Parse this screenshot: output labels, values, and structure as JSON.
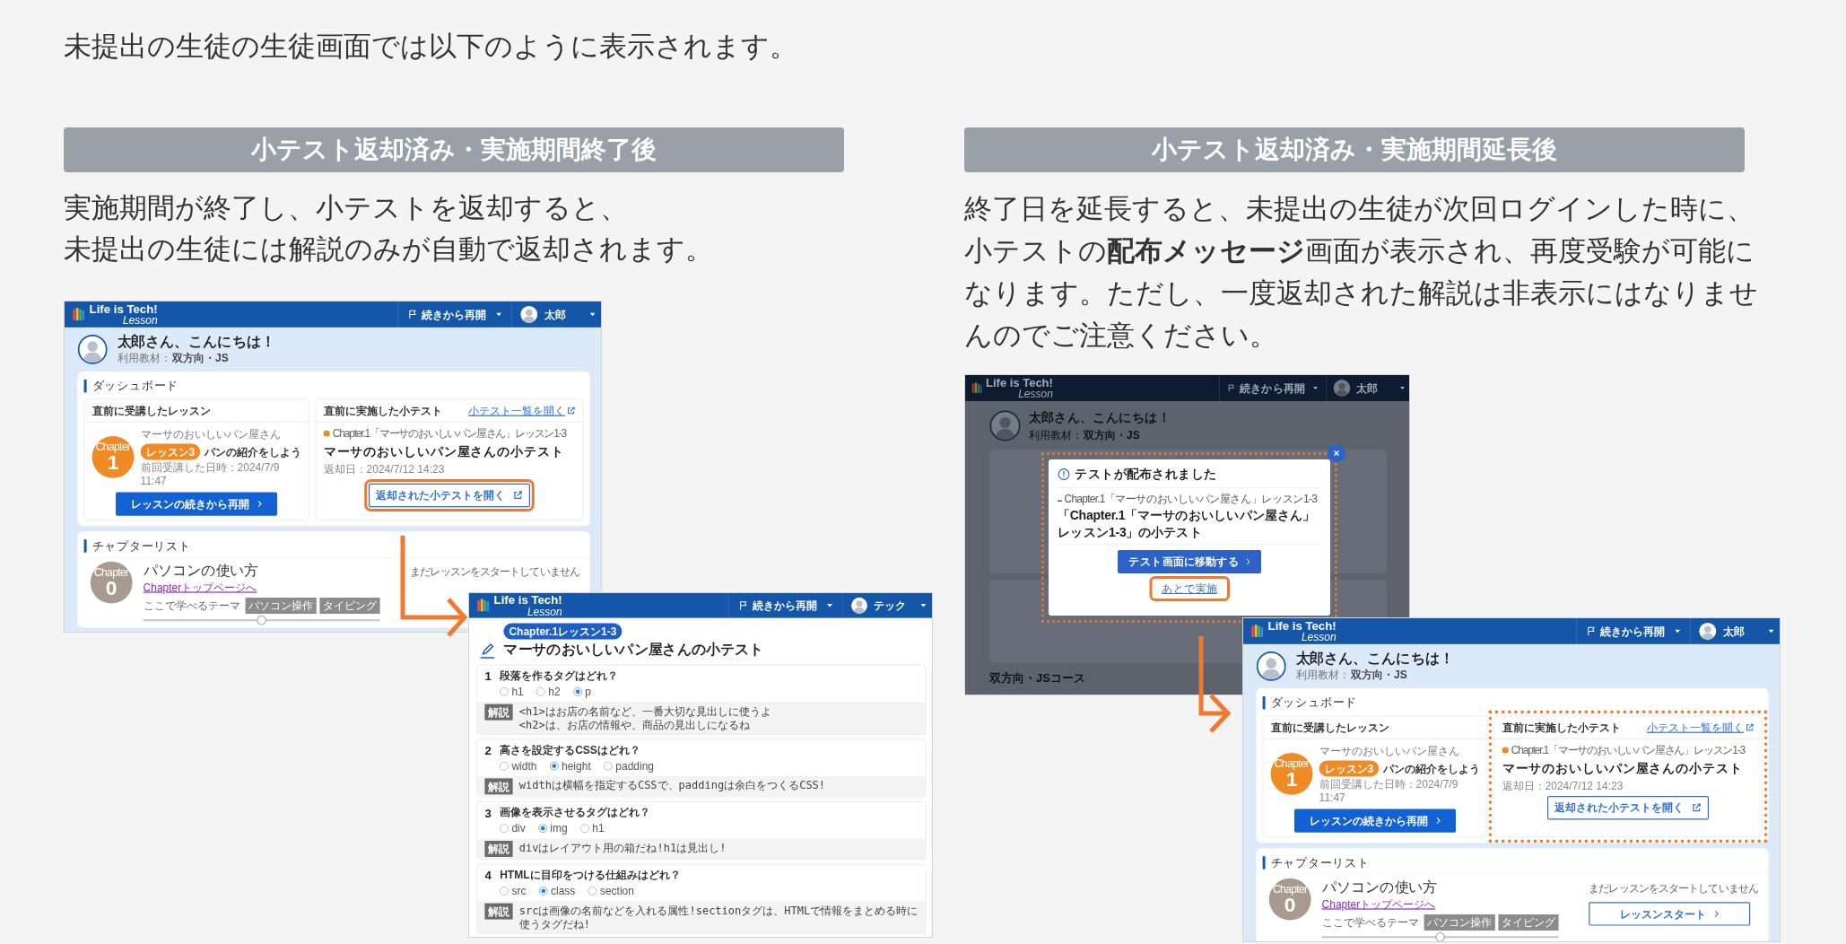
{
  "intro": "未提出の生徒の生徒画面では以下のように表示されます。",
  "columns": [
    {
      "heading": "小テスト返却済み・実施期間終了後",
      "lines": [
        "実施期間が終了し、小テストを返却すると、",
        "未提出の生徒には解説のみが自動で返却されます。"
      ],
      "screens": [
        {
          "kind": "dashboard",
          "logo": {
            "name": "Life is Tech!",
            "sub": "Lesson"
          },
          "topbar": {
            "resume": "続きから再開",
            "user": "太郎"
          },
          "greeting": "太郎さん、こんにちは！",
          "material_label": "利用教材：",
          "material": "双方向・JS",
          "dashboard_title": "ダッシュボード",
          "last_lesson": {
            "title": "直前に受講したレッスン",
            "chapter_label": "Chapter",
            "chapter_number": "1",
            "course": "マーサのおいしいパン屋さん",
            "lesson_badge": "レッスン3",
            "lesson_title": "パンの紹介をしよう",
            "last_viewed": "前回受講した日時：2024/7/9 11:47",
            "button": "レッスンの続きから再開"
          },
          "last_quiz": {
            "title": "直前に実施した小テスト",
            "list_link": "小テスト一覧を開く",
            "chapter_line": "Chapter.1「マーサのおいしいパン屋さん」レッスン1-3",
            "quiz_title": "マーサのおいしいパン屋さんの小テスト",
            "returned": "返却日：2024/7/12 14:23",
            "button": "返却された小テストを開く",
            "highlighted": false,
            "button_highlighted": true
          },
          "chapter_list": {
            "title": "チャプターリスト",
            "chapter_label": "Chapter",
            "chapter_number": "0",
            "name": "パソコンの使い方",
            "link": "Chapterトップページへ",
            "themes_label": "ここで学べるテーマ",
            "tags": [
              "パソコン操作",
              "タイピング"
            ],
            "level": 0.5,
            "status": "まだレッスンをスタートしていません"
          }
        },
        {
          "kind": "quiz",
          "logo": {
            "name": "Life is Tech!",
            "sub": "Lesson"
          },
          "topbar": {
            "resume": "続きから再開",
            "user": "テック"
          },
          "badge": "Chapter.1レッスン1-3",
          "title": "マーサのおいしいパン屋さんの小テスト",
          "questions": [
            {
              "number": "1",
              "text": "段落を作るタグはどれ？",
              "options": [
                {
                  "label": "h1",
                  "selected": false
                },
                {
                  "label": "h2",
                  "selected": false
                },
                {
                  "label": "p",
                  "selected": true
                }
              ],
              "explanation_label": "解説",
              "explanation": [
                "<h1>はお店の名前など、一番大切な見出しに使うよ",
                "<h2>は、お店の情報や、商品の見出しになるね"
              ]
            },
            {
              "number": "2",
              "text": "高さを設定するCSSはどれ？",
              "options": [
                {
                  "label": "width",
                  "selected": false
                },
                {
                  "label": "height",
                  "selected": true
                },
                {
                  "label": "padding",
                  "selected": false
                }
              ],
              "explanation_label": "解説",
              "explanation": [
                "widthは横幅を指定するCSSで、paddingは余白をつくるCSS!"
              ]
            },
            {
              "number": "3",
              "text": "画像を表示させるタグはどれ？",
              "options": [
                {
                  "label": "div",
                  "selected": false
                },
                {
                  "label": "img",
                  "selected": true
                },
                {
                  "label": "h1",
                  "selected": false
                }
              ],
              "explanation_label": "解説",
              "explanation": [
                "divはレイアウト用の箱だね!h1は見出し!"
              ]
            },
            {
              "number": "4",
              "text": "HTMLに目印をつける仕組みはどれ？",
              "options": [
                {
                  "label": "src",
                  "selected": false
                },
                {
                  "label": "class",
                  "selected": true
                },
                {
                  "label": "section",
                  "selected": false
                }
              ],
              "explanation_label": "解説",
              "explanation": [
                "srcは画像の名前などを入れる属性!sectionタグは、HTMLで情報をまとめる時に使うタグだね!"
              ]
            }
          ]
        }
      ]
    },
    {
      "heading": "小テスト返却済み・実施期間延長後",
      "paragraph": "終了日を延長すると、未提出の生徒が次回ログインした時に、小テストの**配布メッセージ**画面が表示され、再度受験が可能になります。ただし、一度返却された解説は非表示にはなりませんのでご注意ください。",
      "screens": [
        {
          "kind": "modal",
          "logo": {
            "name": "Life is Tech!",
            "sub": "Lesson"
          },
          "topbar": {
            "resume": "続きから再開",
            "user": "太郎"
          },
          "greeting": "太郎さん、こんにちは！",
          "material_label": "利用教材：",
          "material": "双方向・JS",
          "course_heading": "双方向・JSコース",
          "dialog": {
            "title": "テストが配布されました",
            "chapter_line": "Chapter.1「マーサのおいしいパン屋さん」レッスン1-3",
            "quiz_title": "「Chapter.1「マーサのおいしいパン屋さん」レッスン1-3」の小テスト",
            "button": "テスト画面に移動する",
            "later_link": "あとで実施",
            "highlighted": true,
            "later_link_highlighted": true
          }
        },
        {
          "kind": "dashboard",
          "logo": {
            "name": "Life is Tech!",
            "sub": "Lesson"
          },
          "topbar": {
            "resume": "続きから再開",
            "user": "太郎"
          },
          "greeting": "太郎さん、こんにちは！",
          "material_label": "利用教材：",
          "material": "双方向・JS",
          "dashboard_title": "ダッシュボード",
          "last_lesson": {
            "title": "直前に受講したレッスン",
            "chapter_label": "Chapter",
            "chapter_number": "1",
            "course": "マーサのおいしいパン屋さん",
            "lesson_badge": "レッスン3",
            "lesson_title": "パンの紹介をしよう",
            "last_viewed": "前回受講した日時：2024/7/9 11:47",
            "button": "レッスンの続きから再開"
          },
          "last_quiz": {
            "title": "直前に実施した小テスト",
            "list_link": "小テスト一覧を開く",
            "chapter_line": "Chapter.1「マーサのおいしいパン屋さん」レッスン1-3",
            "quiz_title": "マーサのおいしいパン屋さんの小テスト",
            "returned": "返却日：2024/7/12 14:23",
            "button": "返却された小テストを開く",
            "highlighted": true,
            "button_highlighted": false
          },
          "chapter_list": {
            "title": "チャプターリスト",
            "chapter_label": "Chapter",
            "chapter_number": "0",
            "name": "パソコンの使い方",
            "link": "Chapterトップページへ",
            "themes_label": "ここで学べるテーマ",
            "tags": [
              "パソコン操作",
              "タイピング"
            ],
            "level": 0.5,
            "status": "まだレッスンをスタートしていません",
            "start_button": "レッスンスタート"
          }
        }
      ]
    }
  ]
}
